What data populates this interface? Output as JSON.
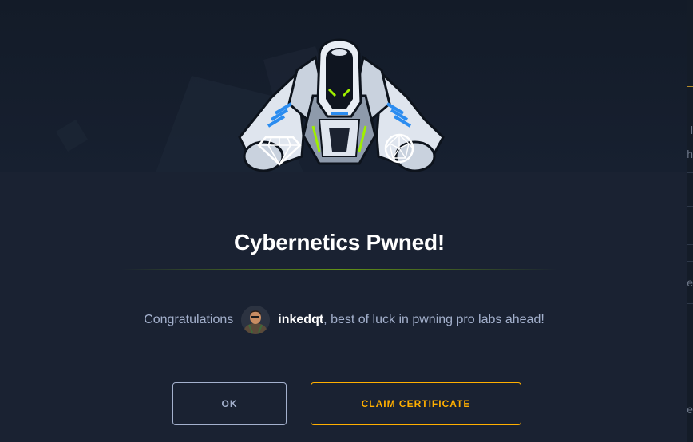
{
  "modal": {
    "title": "Cybernetics Pwned!",
    "message": {
      "prefix": "Congratulations",
      "username": "inkedqt",
      "suffix": ", best of luck in pwning pro labs ahead!"
    }
  },
  "buttons": {
    "ok_label": "OK",
    "claim_label": "CLAIM CERTIFICATE"
  },
  "backdrop": {
    "glyphs": [
      "l",
      "h",
      "e",
      "e"
    ]
  },
  "colors": {
    "background": "#1a2232",
    "accent": "#ffaf00",
    "accent_green": "#9fef00",
    "text_muted": "#a4b1cd",
    "icon_blue": "#2b8cf0"
  },
  "icons": [
    "robot-mascot",
    "diamond-icon",
    "polyhedron-icon",
    "avatar"
  ]
}
